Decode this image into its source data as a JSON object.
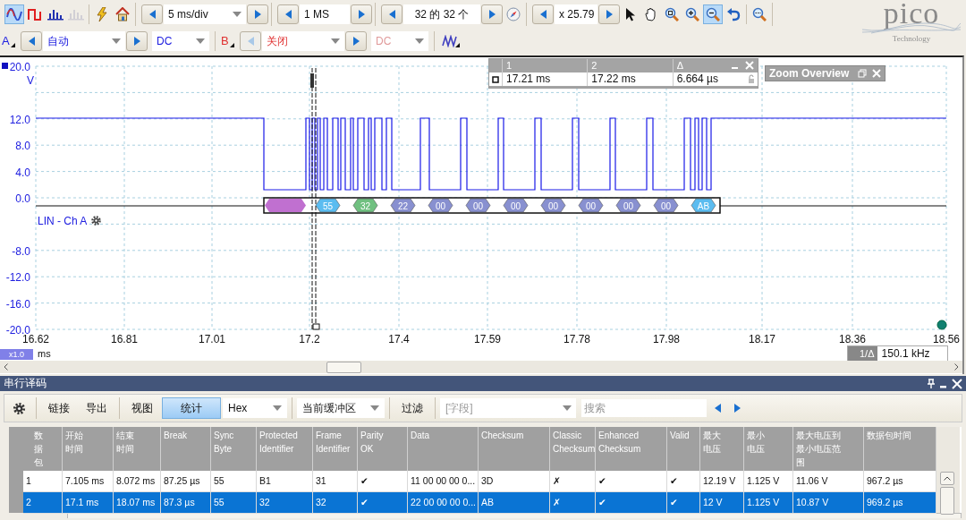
{
  "toolbar": {
    "view_modes": [
      {
        "kind": "scope",
        "selected": true,
        "disabled": false
      },
      {
        "kind": "persistence",
        "selected": false,
        "disabled": false
      },
      {
        "kind": "spectrum",
        "selected": false,
        "disabled": false
      },
      {
        "kind": "spectrum",
        "selected": false,
        "disabled": true
      }
    ],
    "timebase": "5 ms/div",
    "samples": "1 MS",
    "buffer": "32 的 32 个",
    "zoom": "x 25.79",
    "tools": [
      {
        "kind": "pointer",
        "selected": false
      },
      {
        "kind": "hand",
        "selected": false
      },
      {
        "kind": "zoom_box",
        "selected": false
      },
      {
        "kind": "zoom_in",
        "selected": false
      },
      {
        "kind": "zoom_out",
        "selected": true
      },
      {
        "kind": "undo",
        "selected": false
      },
      {
        "kind": "zoom_fit",
        "selected": false
      }
    ]
  },
  "channels": [
    {
      "name": "A",
      "color": "#2020e0",
      "range": "自动",
      "coupling": "DC",
      "enabled": true
    },
    {
      "name": "B",
      "color": "#e03030",
      "range": "关闭",
      "coupling": "DC",
      "enabled": false
    }
  ],
  "logo": {
    "name": "pico",
    "tagline": "Technology"
  },
  "scope": {
    "y_labels": [
      "20.0",
      "12.0",
      "8.0",
      "4.0",
      "0.0",
      "-8.0",
      "-12.0",
      "-16.0",
      "-20.0"
    ],
    "y_unit": "V",
    "x_labels": [
      "16.62",
      "16.81",
      "17.01",
      "17.2",
      "17.4",
      "17.59",
      "17.78",
      "17.98",
      "18.17",
      "18.36",
      "18.56"
    ],
    "x_scale": "x1.0",
    "x_unit": "ms",
    "decoder_label": "LIN - Ch A",
    "decoded": [
      {
        "kind": "break",
        "color": "#c070d0"
      },
      {
        "kind": "byte",
        "label": "55",
        "color": "#5bbcf0"
      },
      {
        "kind": "byte",
        "label": "32",
        "color": "#70c080"
      },
      {
        "kind": "byte",
        "label": "22",
        "color": "#8890d0"
      },
      {
        "kind": "byte",
        "label": "00",
        "color": "#8890d0"
      },
      {
        "kind": "byte",
        "label": "00",
        "color": "#8890d0"
      },
      {
        "kind": "byte",
        "label": "00",
        "color": "#8890d0"
      },
      {
        "kind": "byte",
        "label": "00",
        "color": "#8890d0"
      },
      {
        "kind": "byte",
        "label": "00",
        "color": "#8890d0"
      },
      {
        "kind": "byte",
        "label": "00",
        "color": "#8890d0"
      },
      {
        "kind": "byte",
        "label": "00",
        "color": "#8890d0"
      },
      {
        "kind": "byte",
        "label": "AB",
        "color": "#5bbcf0"
      }
    ],
    "cursor_table": {
      "headers": [
        "1",
        "2",
        "Δ"
      ],
      "values": [
        "17.21 ms",
        "17.22 ms",
        "6.664 µs"
      ]
    },
    "zoom_overview": {
      "title": "Zoom Overview"
    },
    "frequency": {
      "label": "1/Δ",
      "value": "150.1 kHz"
    }
  },
  "decoder": {
    "title": "串行译码",
    "buttons": [
      "链接",
      "导出"
    ],
    "views": [
      {
        "label": "视图",
        "selected": false
      },
      {
        "label": "统计",
        "selected": true
      }
    ],
    "format": "Hex",
    "source": "当前缓冲区",
    "filter": "过滤",
    "field_placeholder": "[字段]",
    "search_placeholder": "搜索",
    "columns": [
      "数据包",
      "开始时间",
      "结束时间",
      "Break",
      "Sync\nByte",
      "Protected\nIdentifier",
      "Frame\nIdentifier",
      "Parity\nOK",
      "Data",
      "Checksum",
      "Classic\nChecksum",
      "Enhanced\nChecksum",
      "Valid",
      "最大电压",
      "最小电压",
      "最大电压到最小电压范围",
      "数据包时间"
    ],
    "rows": [
      {
        "selected": false,
        "cells": [
          "1",
          "7.105 ms",
          "8.072 ms",
          "87.25 µs",
          "55",
          "B1",
          "31",
          "✔",
          "11 00 00 00 0...",
          "3D",
          "✗",
          "✔",
          "✔",
          "12.19 V",
          "1.125 V",
          "11.06 V",
          "967.2 µs"
        ]
      },
      {
        "selected": true,
        "cells": [
          "2",
          "17.1 ms",
          "18.07 ms",
          "87.3 µs",
          "55",
          "32",
          "32",
          "✔",
          "22 00 00 00 0...",
          "AB",
          "✗",
          "✔",
          "✔",
          "12 V",
          "1.125 V",
          "10.87 V",
          "969.2 µs"
        ]
      }
    ]
  }
}
